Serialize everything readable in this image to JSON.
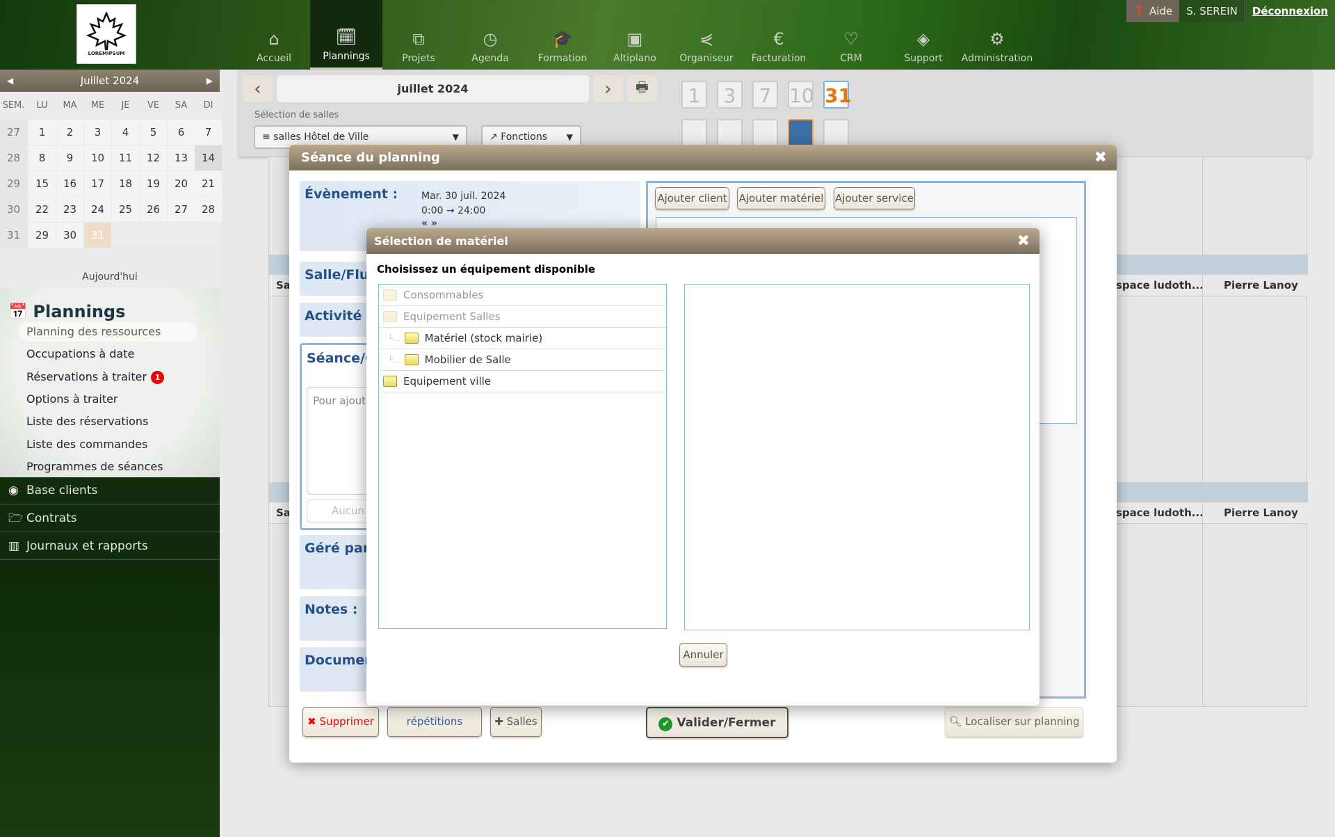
{
  "header": {
    "logo_text": "LOREMIPSUM",
    "nav": [
      {
        "label": "Accueil",
        "icon": "home-icon",
        "glyph": "⌂"
      },
      {
        "label": "Plannings",
        "icon": "calendar-check-icon",
        "glyph": "🗓",
        "active": true
      },
      {
        "label": "Projets",
        "icon": "sitemap-icon",
        "glyph": "⧉"
      },
      {
        "label": "Agenda",
        "icon": "clock-icon",
        "glyph": "◷"
      },
      {
        "label": "Formation",
        "icon": "graduation-cap-icon",
        "glyph": "🎓"
      },
      {
        "label": "Altiplano",
        "icon": "image-icon",
        "glyph": "▣"
      },
      {
        "label": "Organiseur",
        "icon": "share-icon",
        "glyph": "⋞"
      },
      {
        "label": "Facturation",
        "icon": "euro-icon",
        "glyph": "€"
      },
      {
        "label": "CRM",
        "icon": "handshake-icon",
        "glyph": "♡"
      },
      {
        "label": "Support",
        "icon": "ticket-icon",
        "glyph": "◈"
      },
      {
        "label": "Administration",
        "icon": "gear-icon",
        "glyph": "⚙"
      }
    ],
    "help": "Aide",
    "user": "S. SEREIN",
    "logout": "Déconnexion"
  },
  "calendar": {
    "title": "Juillet 2024",
    "dow": [
      "SEM.",
      "LU",
      "MA",
      "ME",
      "JE",
      "VE",
      "SA",
      "DI"
    ],
    "weeks": [
      {
        "w": "27",
        "d": [
          "1",
          "2",
          "3",
          "4",
          "5",
          "6",
          "7"
        ]
      },
      {
        "w": "28",
        "d": [
          "8",
          "9",
          "10",
          "11",
          "12",
          "13",
          "14"
        ]
      },
      {
        "w": "29",
        "d": [
          "15",
          "16",
          "17",
          "18",
          "19",
          "20",
          "21"
        ]
      },
      {
        "w": "30",
        "d": [
          "22",
          "23",
          "24",
          "25",
          "26",
          "27",
          "28"
        ]
      },
      {
        "w": "31",
        "d": [
          "29",
          "30",
          "31",
          "",
          "",
          "",
          ""
        ]
      }
    ],
    "today_day": "31",
    "today_label": "Aujourd'hui"
  },
  "menu": {
    "title": "Plannings",
    "items": [
      "Planning des ressources",
      "Occupations à date",
      "Réservations à traiter",
      "Options à traiter",
      "Liste des réservations",
      "Liste des commandes",
      "Programmes de séances"
    ],
    "badge": "1",
    "sections": [
      {
        "label": "Base clients",
        "icon": "user-circle-icon"
      },
      {
        "label": "Contrats",
        "icon": "folder-open-icon"
      },
      {
        "label": "Journaux et rapports",
        "icon": "bar-chart-icon"
      }
    ]
  },
  "toolbar": {
    "month": "juillet 2024",
    "salles_label": "Sélection de salles",
    "salles_value": "salles Hôtel de Ville",
    "fonctions": "Fonctions",
    "day_ranges": [
      "1",
      "3",
      "7",
      "10",
      "31"
    ],
    "active_range": "31"
  },
  "background": {
    "header_cell": "Sa",
    "col_a": "space ludoth...",
    "col_b": "Pierre Lanoy"
  },
  "seance": {
    "title": "Séance du planning",
    "evenement_label": "Évènement :",
    "date": "Mar. 30 juil. 2024",
    "time": "0:00 → 24:00",
    "nav": "« »",
    "salle_label": "Salle/Flux",
    "activite_label": "Activité :",
    "seance_label": "Séance/C",
    "add_placeholder": "Pour ajoute",
    "aucun": "Aucun",
    "gere_label": "Géré par :",
    "notes_label": "Notes :",
    "docs_label": "Documen",
    "add_client": "Ajouter client",
    "add_materiel": "Ajouter matériel",
    "add_service": "Ajouter service",
    "delete": "Supprimer",
    "repetitions": "répétitions",
    "salles": "Salles",
    "validate": "Valider/Fermer",
    "locate": "Localiser sur planning"
  },
  "materiel": {
    "title": "Sélection de matériel",
    "heading": "Choisissez un équipement disponible",
    "tree": [
      {
        "label": "Consommables",
        "level": 0,
        "disabled": true
      },
      {
        "label": "Equipement Salles",
        "level": 0,
        "disabled": true
      },
      {
        "label": "Matériel (stock mairie)",
        "level": 1,
        "disabled": false
      },
      {
        "label": "Mobilier de Salle",
        "level": 1,
        "disabled": false
      },
      {
        "label": "Equipement ville",
        "level": 0,
        "disabled": false
      }
    ],
    "cancel": "Annuler"
  }
}
